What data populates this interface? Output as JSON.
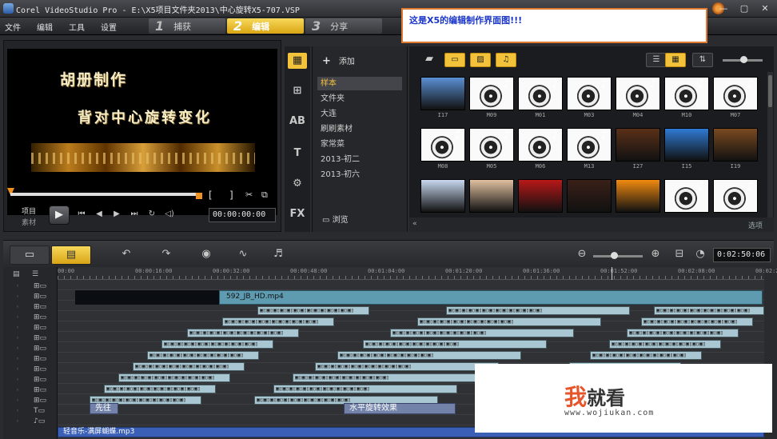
{
  "window": {
    "title": "Corel VideoStudio Pro - E:\\X5项目文件夹2013\\中心旋转X5-707.VSP",
    "min": "—",
    "max": "▢",
    "close": "✕"
  },
  "menu": {
    "file": "文件",
    "edit": "编辑",
    "tools": "工具",
    "settings": "设置"
  },
  "steps": [
    {
      "num": "1",
      "label": "捕获"
    },
    {
      "num": "2",
      "label": "编辑"
    },
    {
      "num": "3",
      "label": "分享"
    }
  ],
  "annotation": "这是X5的编辑制作界面图!!!",
  "preview": {
    "line1": "胡册制作",
    "line2": "背对中心旋转变化",
    "proj_label": "项目",
    "clip_label": "素材",
    "timecode": "00:00:00:00",
    "mark_open": "[",
    "mark_close": "]"
  },
  "library": {
    "add_label": "添加",
    "folders": [
      "样本",
      "文件夹",
      "大连",
      "刷刷素材",
      "家常菜",
      "2013-初二",
      "2013-初六"
    ],
    "browse_label": "浏览",
    "options_label": "选项",
    "thumbs": [
      {
        "label": "I17",
        "kind": "image",
        "color": "#5a8fd4"
      },
      {
        "label": "M09",
        "kind": "music"
      },
      {
        "label": "M01",
        "kind": "music"
      },
      {
        "label": "M03",
        "kind": "music"
      },
      {
        "label": "M04",
        "kind": "music"
      },
      {
        "label": "M10",
        "kind": "music"
      },
      {
        "label": "M07",
        "kind": "music"
      },
      {
        "label": "M08",
        "kind": "music"
      },
      {
        "label": "M05",
        "kind": "music"
      },
      {
        "label": "M06",
        "kind": "music"
      },
      {
        "label": "M13",
        "kind": "music"
      },
      {
        "label": "I27",
        "kind": "image",
        "color": "#5a3018"
      },
      {
        "label": "I15",
        "kind": "image",
        "color": "#2f7ad4"
      },
      {
        "label": "I19",
        "kind": "image",
        "color": "#7a4a20"
      },
      {
        "label": "",
        "kind": "image",
        "color": "#c8d8f0"
      },
      {
        "label": "",
        "kind": "image",
        "color": "#e0c0a0"
      },
      {
        "label": "",
        "kind": "image",
        "color": "#b81818"
      },
      {
        "label": "",
        "kind": "image",
        "color": "#3a2018"
      },
      {
        "label": "",
        "kind": "image",
        "color": "#f08a10"
      },
      {
        "label": "",
        "kind": "music"
      },
      {
        "label": "",
        "kind": "music"
      }
    ]
  },
  "timeline": {
    "time": "0:02:50:06",
    "ticks": [
      "00:00",
      "00:00:16:00",
      "00:00:32:00",
      "00:00:48:00",
      "00:01:04:00",
      "00:01:20:00",
      "00:01:36:00",
      "00:01:52:00",
      "00:02:08:00",
      "00:02:24:00"
    ],
    "video_clip": "592_JB_HD.mp4",
    "title_clips": [
      "先往",
      "水平旋转效果"
    ],
    "audio_clip": "轻音乐-满屏蝴蝶.mp3"
  },
  "watermark": {
    "logo_a": "我",
    "logo_b": "就看",
    "url": "www.wojiukan.com"
  },
  "colors": {
    "accent": "#f2c23a",
    "annotation_text": "#1a35c8",
    "annotation_border": "#e07a30"
  }
}
